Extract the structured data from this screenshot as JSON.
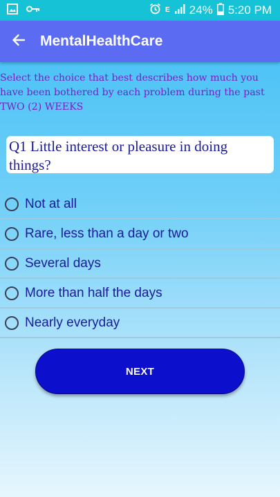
{
  "status_bar": {
    "battery_percent": "24%",
    "time": "5:20 PM",
    "network_letters": "E",
    "icons": [
      "image-icon",
      "key-icon",
      "alarm-icon",
      "signal-icon",
      "battery-icon"
    ]
  },
  "app_bar": {
    "title": "MentalHealthCare",
    "back_icon": "arrow-left-icon"
  },
  "instructions": "Select the choice that best describes how much you have been bothered by each problem during the past TWO (2) WEEKS",
  "question": {
    "text": "Q1 Little interest or pleasure in doing things?"
  },
  "options": [
    {
      "label": "Not at all",
      "selected": false
    },
    {
      "label": "Rare, less than a day or two",
      "selected": false
    },
    {
      "label": "Several days",
      "selected": false
    },
    {
      "label": "More than half the days",
      "selected": false
    },
    {
      "label": "Nearly everyday",
      "selected": false
    }
  ],
  "next_button": {
    "label": "NEXT"
  },
  "colors": {
    "status_bar": "#15c2d6",
    "app_bar": "#5b6cf3",
    "instructions_text": "#7a1fc6",
    "option_text": "#1a1a9a",
    "button": "#0c0fcb"
  }
}
